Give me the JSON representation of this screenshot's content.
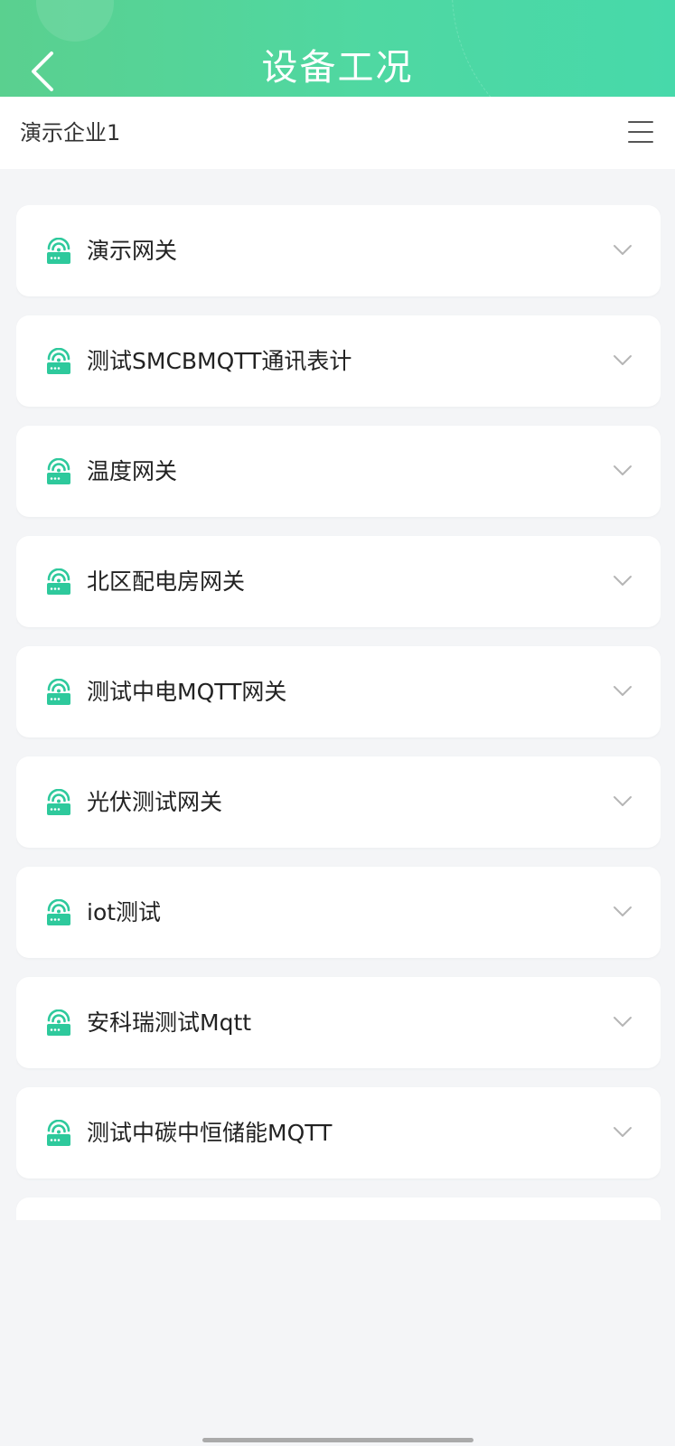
{
  "header": {
    "title": "设备工况",
    "back_icon": "chevron-left-icon",
    "gradient_start": "#5ad08f",
    "gradient_end": "#47d9aa"
  },
  "company": {
    "name": "演示企业1",
    "menu_icon": "hamburger-menu-icon"
  },
  "devices": [
    {
      "name": "演示网关"
    },
    {
      "name": "测试SMCBMQTT通讯表计"
    },
    {
      "name": "温度网关"
    },
    {
      "name": "北区配电房网关"
    },
    {
      "name": "测试中电MQTT网关"
    },
    {
      "name": "光伏测试网关"
    },
    {
      "name": "iot测试"
    },
    {
      "name": "安科瑞测试Mqtt"
    },
    {
      "name": "测试中碳中恒储能MQTT"
    },
    {
      "name": ""
    }
  ],
  "icons": {
    "device": "router-wifi-icon",
    "expand": "chevron-down-icon"
  },
  "colors": {
    "accent": "#2ec99c",
    "background": "#f4f5f7",
    "card": "#ffffff"
  }
}
